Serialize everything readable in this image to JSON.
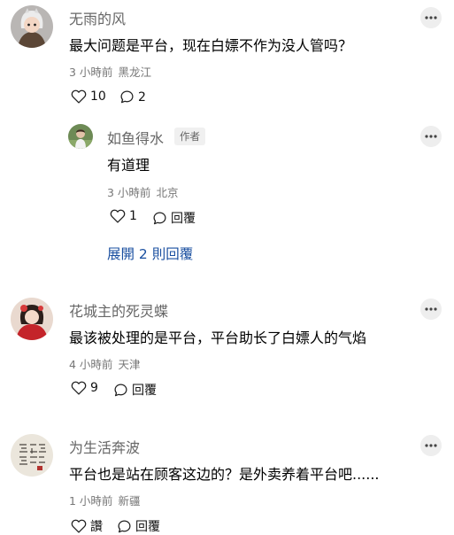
{
  "comments": [
    {
      "name": "无雨的风",
      "text": "最大问题是平台，现在白嫖不作为没人管吗？",
      "time": "3 小時前",
      "location": "黑龙江",
      "likes": "10",
      "replies": "2",
      "icons": {
        "avatar": "girl-white-hood-avatar",
        "more": "more-dots-icon",
        "like": "heart-outline-icon",
        "reply": "comment-bubble-icon"
      }
    },
    {
      "name": "花城主的死灵蝶",
      "text": "最该被处理的是平台，平台助长了白嫖人的气焰",
      "time": "4 小時前",
      "location": "天津",
      "likes": "9",
      "reply_label": "回覆",
      "icons": {
        "avatar": "red-costume-avatar"
      }
    },
    {
      "name": "为生活奔波",
      "text": "平台也是站在顾客这边的？是外卖养着平台吧......",
      "time": "1 小時前",
      "location": "新疆",
      "likes": "讚",
      "reply_label": "回覆",
      "icons": {
        "avatar": "calligraphy-avatar"
      }
    }
  ],
  "reply": {
    "name": "如鱼得水",
    "badge": "作者",
    "text": "有道理",
    "time": "3 小時前",
    "location": "北京",
    "likes": "1",
    "reply_label": "回覆",
    "icons": {
      "avatar": "boy-outdoor-avatar"
    }
  },
  "expand_label": "展開 2 則回覆",
  "colors": {
    "name": "#666666",
    "meta": "#777777",
    "link": "#1a4fa0",
    "more_bg": "#eeeeee"
  }
}
